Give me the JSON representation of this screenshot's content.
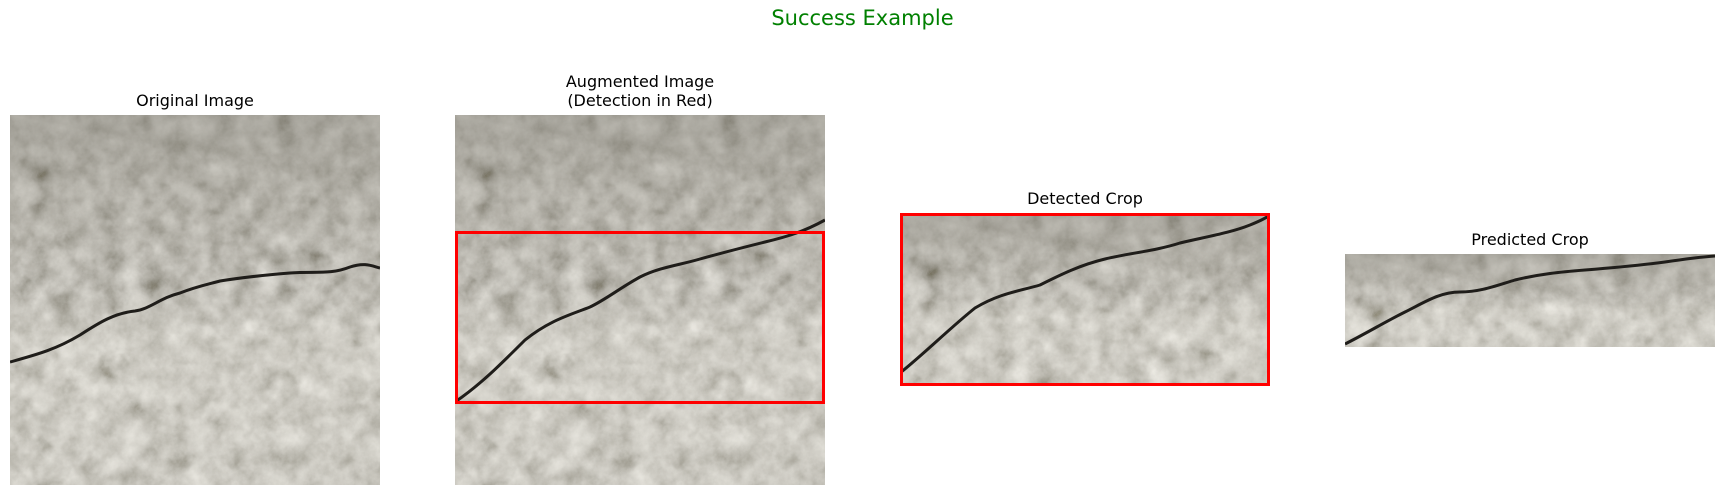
{
  "figure": {
    "title": "Success Example",
    "title_color": "#008000",
    "detection_color": "#ff0000"
  },
  "panels": [
    {
      "title": "Original Image"
    },
    {
      "title": "Augmented Image\n(Detection in Red)"
    },
    {
      "title": "Detected Crop"
    },
    {
      "title": "Predicted Crop"
    }
  ]
}
